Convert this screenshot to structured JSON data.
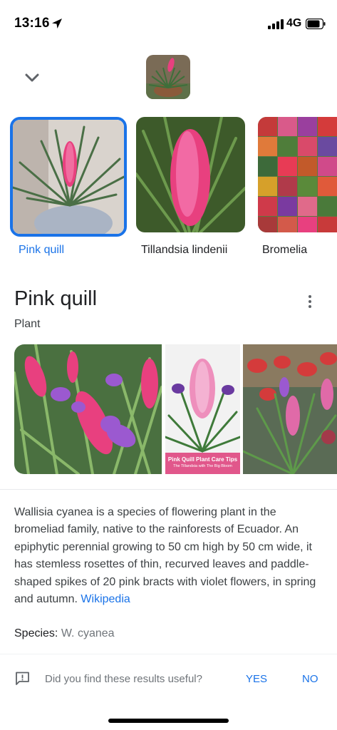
{
  "status_bar": {
    "time": "13:16",
    "network": "4G"
  },
  "header": {
    "collapse_icon": "chevron-down-icon"
  },
  "suggestions": [
    {
      "label": "Pink quill",
      "selected": true
    },
    {
      "label": "Tillandsia lindenii",
      "selected": false
    },
    {
      "label": "Bromelia",
      "selected": false
    }
  ],
  "knowledge_panel": {
    "title": "Pink quill",
    "subtitle": "Plant",
    "gallery_caption_line1": "Pink Quill Plant Care Tips",
    "gallery_caption_line2": "The Tillandsia with The Big Bloom",
    "description": "Wallisia cyanea is a species of flowering plant in the bromeliad family, native to the rainforests of Ecuador. An epiphytic perennial growing to 50 cm high by 50 cm wide, it has stemless rosettes of thin, recurved leaves and paddle-shaped spikes of 20 pink bracts with violet flowers, in spring and autumn.",
    "source_link": "Wikipedia",
    "species_label": "Species:",
    "species_value": "W. cyanea"
  },
  "feedback": {
    "question": "Did you find these results useful?",
    "yes": "YES",
    "no": "NO"
  },
  "colors": {
    "accent": "#1a73e8",
    "pink_bract": "#e8407f",
    "violet_flower": "#9b59d0",
    "leaf_green": "#3f6e3a"
  }
}
